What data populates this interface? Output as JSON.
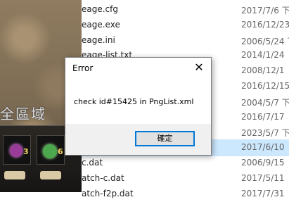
{
  "files": [
    {
      "name": "eage.cfg",
      "date": "2017/7/6 下"
    },
    {
      "name": "eage.exe",
      "date": "2016/12/23"
    },
    {
      "name": "eage.ini",
      "date": "2006/5/24 下"
    },
    {
      "name": "eage-list.txt",
      "date": "2014/1/24"
    },
    {
      "name": "",
      "date": "2008/12/1"
    },
    {
      "name": "",
      "date": "2016/12/15"
    },
    {
      "name": "",
      "date": "2004/5/7 下"
    },
    {
      "name": "",
      "date": "2016/7/17"
    },
    {
      "name": "",
      "date": "2023/5/7 下"
    },
    {
      "name": "",
      "date": "2017/6/10"
    },
    {
      "name": "c.dat",
      "date": "2006/9/15"
    },
    {
      "name": "atch-c.dat",
      "date": "2017/5/11"
    },
    {
      "name": "atch-f2p.dat",
      "date": "2017/7/31"
    }
  ],
  "selected_row_index": 9,
  "game": {
    "region_text": "全區域",
    "slot1_qty": "3",
    "slot2_qty": "6"
  },
  "dialog": {
    "title": "Error",
    "message": "check id#15425 in PngList.xml",
    "ok_label": "確定",
    "close_glyph": "✕"
  }
}
